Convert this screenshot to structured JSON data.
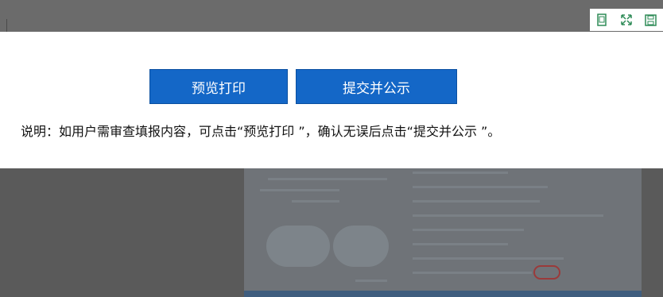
{
  "modal": {
    "preview_print_label": "预览打印",
    "submit_publish_label": "提交并公示",
    "instruction": "说明：如用户需审查填报内容，可点击“预览打印 ”，确认无误后点击“提交并公示 ”。"
  },
  "toolbar": {
    "icons": [
      "restore-window-icon",
      "fullscreen-icon",
      "save-icon"
    ]
  },
  "colors": {
    "button": "#1467c7",
    "icon": "#2e8b57",
    "overlay": "#555555"
  }
}
